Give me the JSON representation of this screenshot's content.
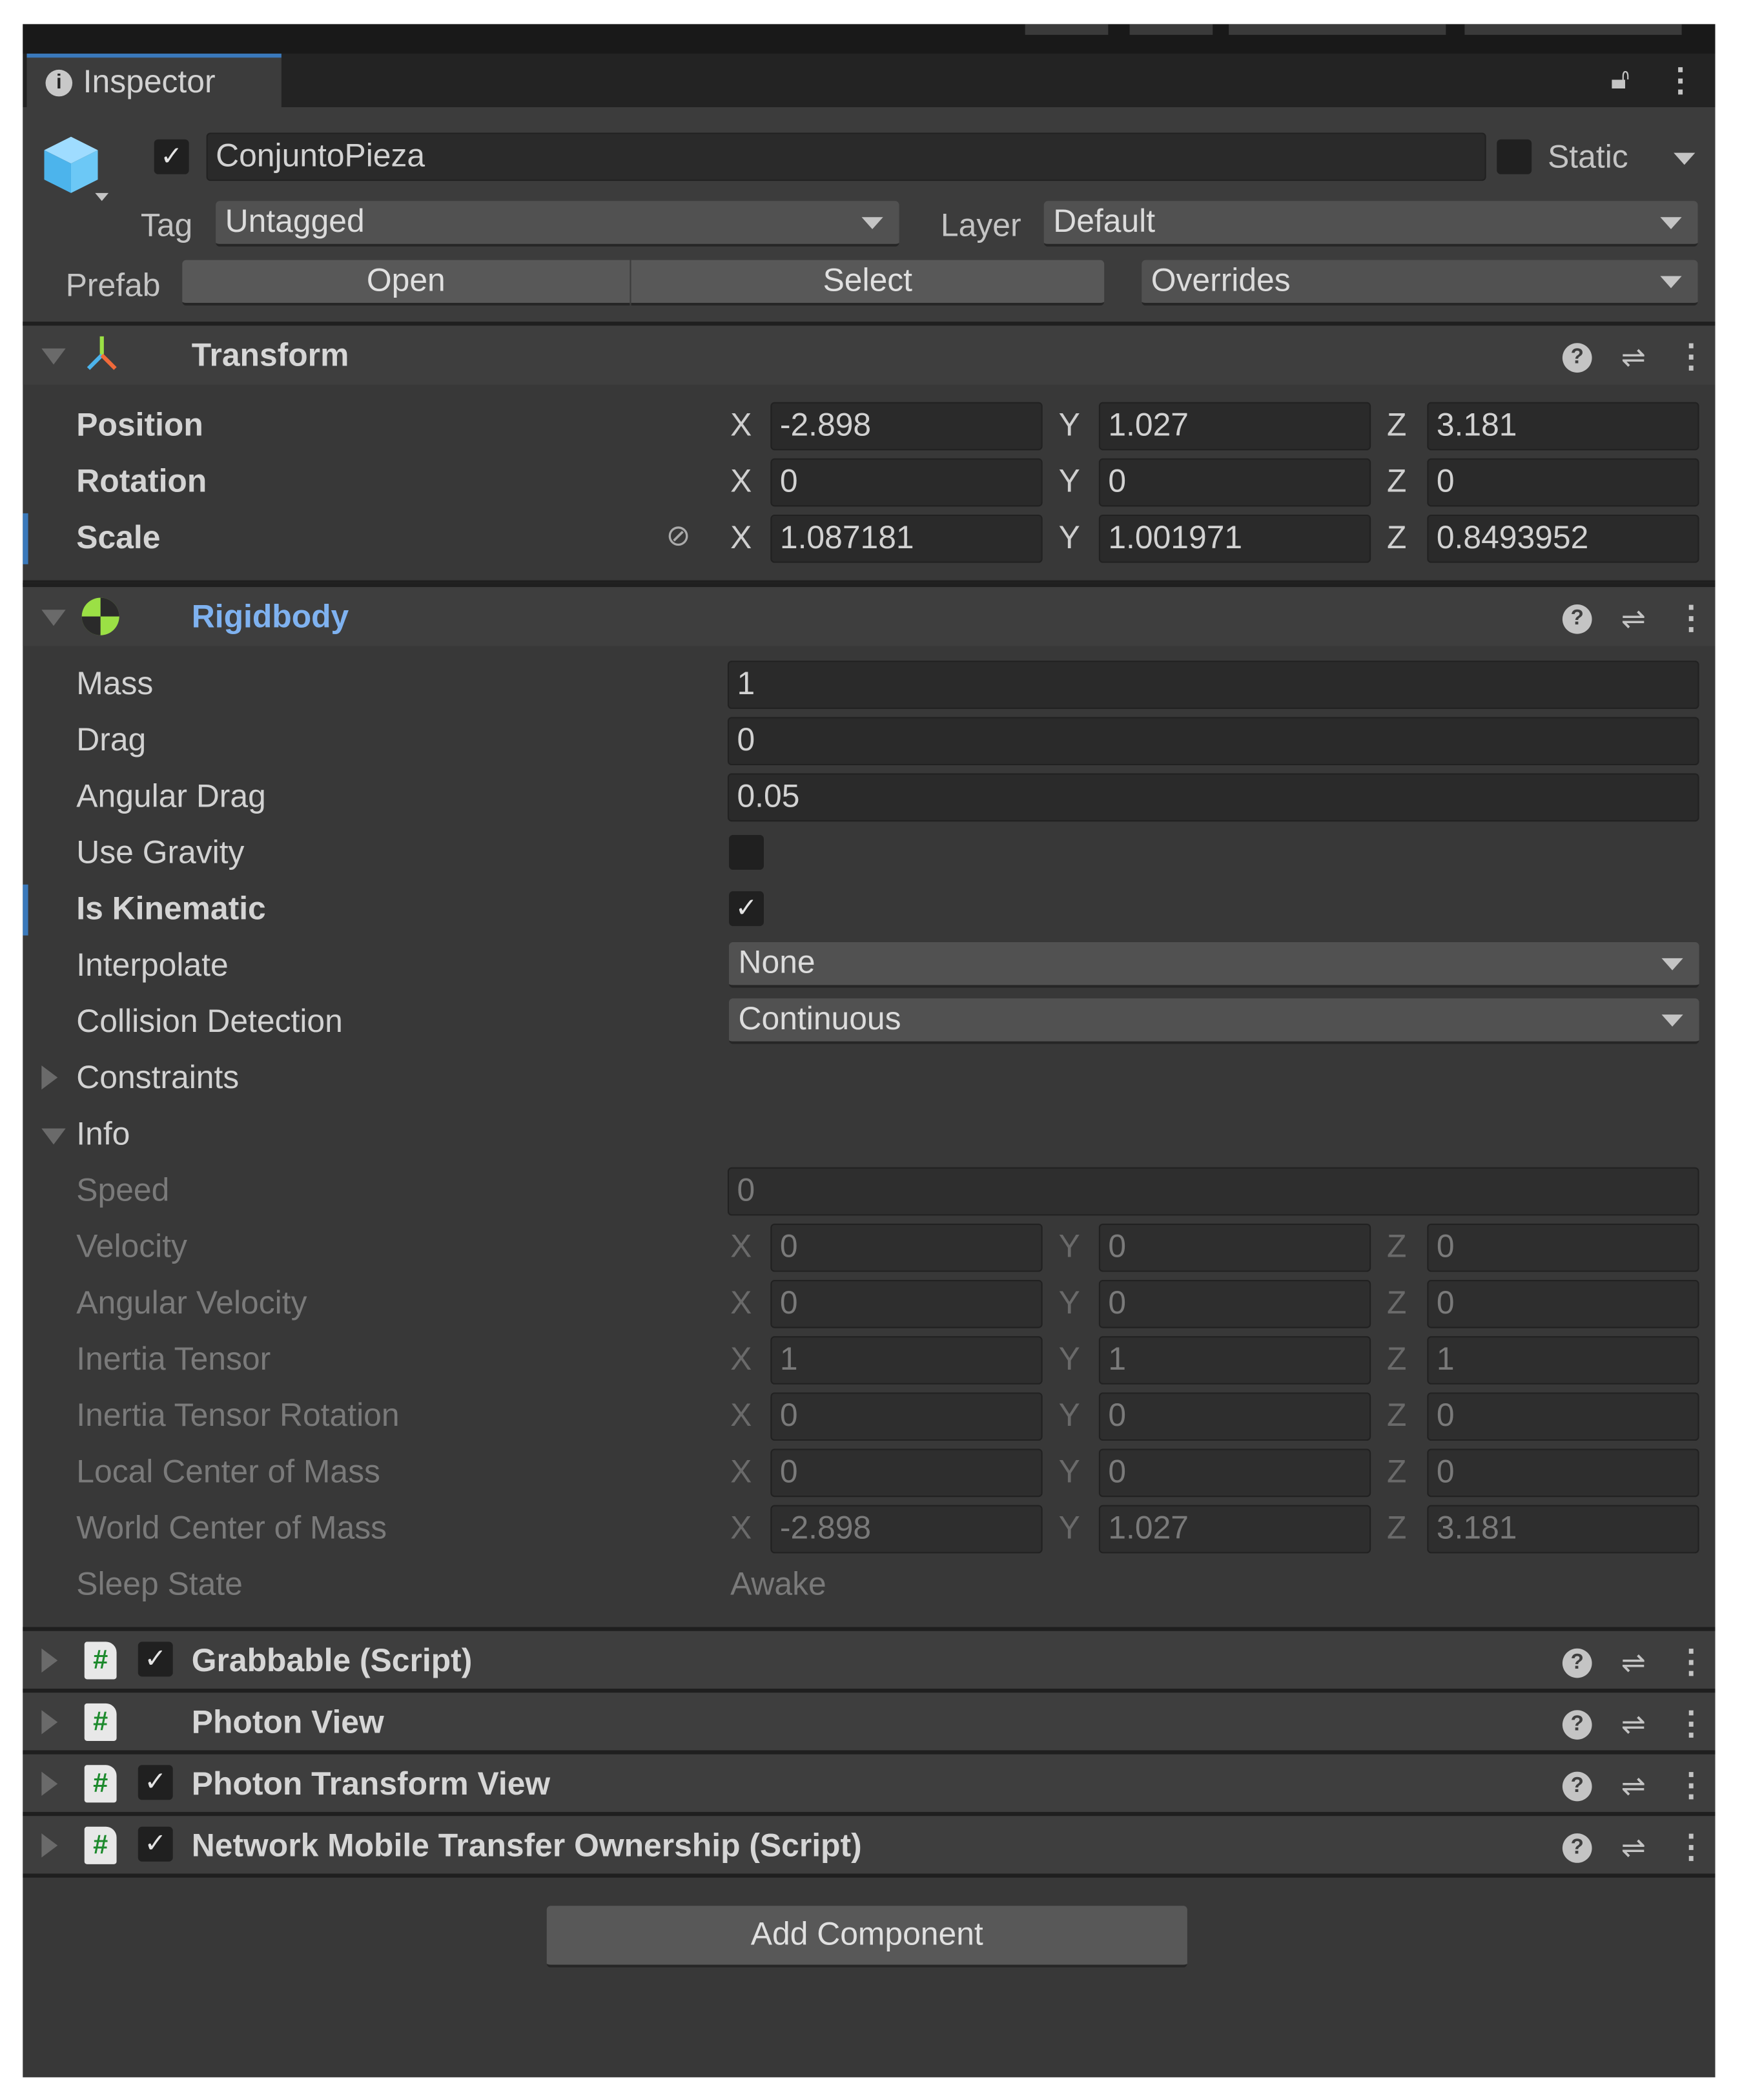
{
  "tab": {
    "label": "Inspector"
  },
  "object": {
    "name": "ConjuntoPieza",
    "active": true,
    "static_label": "Static",
    "tag_label": "Tag",
    "tag": "Untagged",
    "layer_label": "Layer",
    "layer": "Default",
    "prefab_label": "Prefab",
    "open": "Open",
    "select": "Select",
    "overrides": "Overrides"
  },
  "transform": {
    "title": "Transform",
    "rows": [
      {
        "label": "Position",
        "x": "-2.898",
        "y": "1.027",
        "z": "3.181"
      },
      {
        "label": "Rotation",
        "x": "0",
        "y": "0",
        "z": "0"
      },
      {
        "label": "Scale",
        "x": "1.087181",
        "y": "1.001971",
        "z": "0.8493952",
        "modified": true
      }
    ]
  },
  "rigidbody": {
    "title": "Rigidbody",
    "title_color": "#7fb2f0",
    "rows": [
      {
        "type": "field",
        "label": "Mass",
        "value": "1"
      },
      {
        "type": "field",
        "label": "Drag",
        "value": "0"
      },
      {
        "type": "field",
        "label": "Angular Drag",
        "value": "0.05"
      },
      {
        "type": "check",
        "label": "Use Gravity",
        "checked": false
      },
      {
        "type": "check",
        "label": "Is Kinematic",
        "checked": true,
        "modified": true
      },
      {
        "type": "dropdown",
        "label": "Interpolate",
        "value": "None"
      },
      {
        "type": "dropdown",
        "label": "Collision Detection",
        "value": "Continuous"
      },
      {
        "type": "fold",
        "label": "Constraints",
        "open": false
      },
      {
        "type": "fold",
        "label": "Info",
        "open": true
      },
      {
        "type": "field",
        "label": "Speed",
        "value": "0",
        "disabled": true
      },
      {
        "type": "vec",
        "label": "Velocity",
        "x": "0",
        "y": "0",
        "z": "0",
        "disabled": true
      },
      {
        "type": "vec",
        "label": "Angular Velocity",
        "x": "0",
        "y": "0",
        "z": "0",
        "disabled": true
      },
      {
        "type": "vec",
        "label": "Inertia Tensor",
        "x": "1",
        "y": "1",
        "z": "1",
        "disabled": true
      },
      {
        "type": "vec",
        "label": "Inertia Tensor Rotation",
        "x": "0",
        "y": "0",
        "z": "0",
        "disabled": true
      },
      {
        "type": "vec",
        "label": "Local Center of Mass",
        "x": "0",
        "y": "0",
        "z": "0",
        "disabled": true
      },
      {
        "type": "vec",
        "label": "World Center of Mass",
        "x": "-2.898",
        "y": "1.027",
        "z": "3.181",
        "disabled": true
      },
      {
        "type": "text",
        "label": "Sleep State",
        "value": "Awake",
        "disabled": true
      }
    ]
  },
  "components": [
    {
      "title": "Grabbable (Script)",
      "checkbox": true
    },
    {
      "title": "Photon View",
      "checkbox": false
    },
    {
      "title": "Photon Transform View",
      "checkbox": true
    },
    {
      "title": "Network Mobile Transfer Ownership (Script)",
      "checkbox": true
    }
  ],
  "add_component": "Add Component",
  "axes": {
    "x": "X",
    "y": "Y",
    "z": "Z"
  },
  "icons": {
    "help": "?",
    "preset": "⇌",
    "kebab": "⋮",
    "check": "✓"
  }
}
